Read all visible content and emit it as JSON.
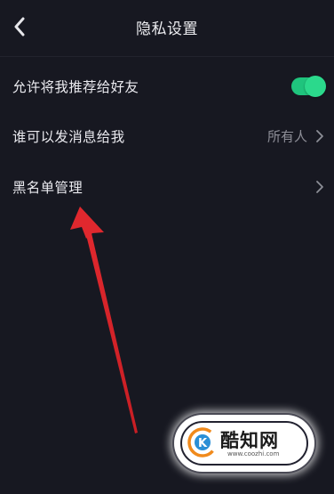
{
  "header": {
    "title": "隐私设置",
    "back_icon": "chevron-left-icon"
  },
  "settings": [
    {
      "label": "允许将我推荐给好友",
      "control": "toggle",
      "toggle_on": true,
      "toggle_color": "#1fc47d"
    },
    {
      "label": "谁可以发消息给我",
      "control": "value-chevron",
      "value": "所有人"
    },
    {
      "label": "黑名单管理",
      "control": "chevron"
    }
  ],
  "annotation": {
    "arrow_color": "#e0282e",
    "points_to": "黑名单管理"
  },
  "watermark": {
    "logo_letter": "K",
    "text": "酷知网",
    "url": "www.coozhi.com"
  }
}
